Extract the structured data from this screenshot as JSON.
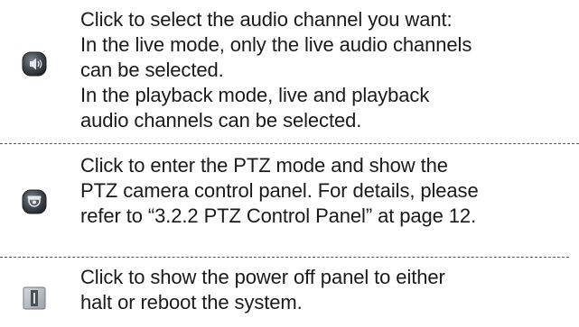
{
  "rows": [
    {
      "icon": "audio-speaker-icon",
      "lines": [
        "Click to select the audio channel you want:",
        "In the live mode, only the live audio channels",
        "can be selected.",
        "In the playback mode, live and playback",
        "audio channels can be selected."
      ]
    },
    {
      "icon": "ptz-camera-icon",
      "lines": [
        "Click to enter the PTZ mode and show the",
        "PTZ camera control panel. For details, please",
        "refer to “3.2.2 PTZ Control Panel” at page 12."
      ]
    },
    {
      "icon": "power-off-icon",
      "lines": [
        "Click to show the power off panel to either",
        "halt or reboot the system."
      ]
    }
  ],
  "colors": {
    "text": "#1a1a1a",
    "divider": "#555555",
    "icon_dark": "#3a3f45",
    "icon_light": "#c9ced3"
  }
}
